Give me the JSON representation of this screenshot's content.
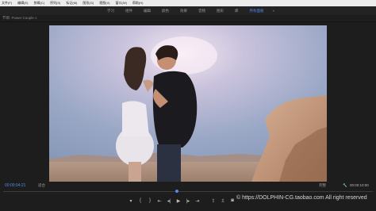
{
  "menu": {
    "items": [
      "文件(F)",
      "编辑(E)",
      "剪辑(C)",
      "序列(S)",
      "标记(M)",
      "图形(G)",
      "视图(V)",
      "窗口(W)",
      "帮助(H)"
    ]
  },
  "workspaces": {
    "tabs": [
      {
        "label": "学习",
        "active": false
      },
      {
        "label": "组件",
        "active": false
      },
      {
        "label": "编辑",
        "active": false
      },
      {
        "label": "颜色",
        "active": false
      },
      {
        "label": "效果",
        "active": false
      },
      {
        "label": "音频",
        "active": false
      },
      {
        "label": "图形",
        "active": false
      },
      {
        "label": "库",
        "active": false
      },
      {
        "label": "所有面板",
        "active": true
      }
    ],
    "more_label": "»"
  },
  "program_panel": {
    "title": "节目: Power Couple  ≡"
  },
  "transport": {
    "timecode_current": "00:00:04:21",
    "fit_label": "适合",
    "quality_label": "完整",
    "wrench_label": "🔧",
    "timecode_duration": "00:00:10:00",
    "playhead_fraction": 0.47
  },
  "controls": {
    "buttons": [
      {
        "name": "add-marker-icon",
        "glyph": "▾"
      },
      {
        "name": "mark-in-icon",
        "glyph": "{"
      },
      {
        "name": "mark-out-icon",
        "glyph": "}"
      },
      {
        "name": "go-to-in-icon",
        "glyph": "⇤"
      },
      {
        "name": "step-back-icon",
        "glyph": "◂|"
      },
      {
        "name": "play-icon",
        "glyph": "▶"
      },
      {
        "name": "step-forward-icon",
        "glyph": "|▸"
      },
      {
        "name": "go-to-out-icon",
        "glyph": "⇥"
      },
      {
        "name": "lift-icon",
        "glyph": "⇪"
      },
      {
        "name": "extract-icon",
        "glyph": "⇫"
      },
      {
        "name": "camera-icon",
        "glyph": "◙"
      }
    ]
  },
  "watermark": {
    "text": "© https://DOLPHIN-CG.taobao.com  All right reserved"
  },
  "colors": {
    "accent": "#4d8de8",
    "background": "#1d1d1d",
    "menubar": "#ececec"
  }
}
